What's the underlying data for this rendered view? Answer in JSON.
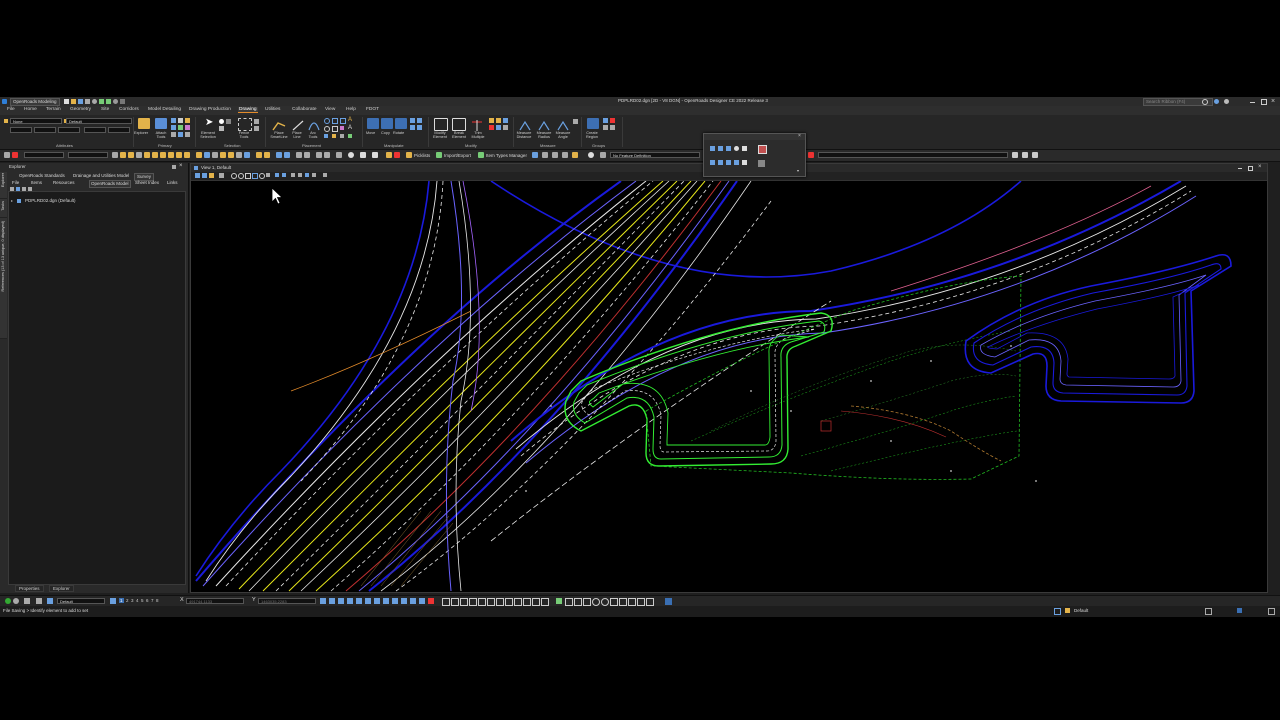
{
  "app": {
    "workflow": "OpenRoads Modeling",
    "title": "PDPLRD02.dgn [2D - V8 DGN] - OpenRoads Designer CE 2022 Release 3",
    "search_placeholder": "Search Ribbon (F4)"
  },
  "menu": {
    "items": [
      "File",
      "Home",
      "Terrain",
      "Geometry",
      "Site",
      "Corridors",
      "Model Detailing",
      "Drawing Production",
      "Drawing",
      "Utilities",
      "Collaborate",
      "View",
      "Help",
      "FDOT"
    ],
    "active": "Drawing"
  },
  "ribbon": {
    "level_value": "None",
    "style_value": "Default",
    "buttons": {
      "explorer": "Explorer",
      "attach_tools": "Attach Tools",
      "element_selection": "Element Selection",
      "fence_tools": "Fence Tools",
      "place_smartline": "Place SmartLine",
      "place_line": "Place Line",
      "arc_tools": "Arc Tools",
      "move": "Move",
      "copy": "Copy",
      "rotate": "Rotate",
      "modify_element": "Modify Element",
      "break_element": "Break Element",
      "trim_multiple": "Trim Multiple",
      "measure_distance": "Measure Distance",
      "measure_radius": "Measure Radius",
      "measure_angle": "Measure Angle",
      "create_region": "Create Region"
    },
    "groups": [
      "Attributes",
      "Primary",
      "Selection",
      "Placement",
      "Manipulate",
      "Modify",
      "Measure",
      "Groups"
    ]
  },
  "toolbar2": {
    "picklists": "Picklists",
    "import_export": "Import/Export",
    "item_types_manager": "Item Types Manager",
    "feature_definition": "No Feature Definition"
  },
  "explorer": {
    "title": "Explorer",
    "tabs_row1": [
      "OpenRoads Standards",
      "Drainage and Utilities Model",
      "Survey"
    ],
    "tabs_row2": [
      "File",
      "Items",
      "Resources",
      "OpenRoads Model",
      "Sheet Index",
      "Links"
    ],
    "side_tabs": [
      "Explorer",
      "Tasks",
      "References (13 of 13 unique, 0 displayed)"
    ],
    "tree_item": "PDPLRD02.dgn (Default)",
    "bottom_tabs": [
      "Properties",
      "Explorer"
    ]
  },
  "view": {
    "title": "View 1, Default"
  },
  "status": {
    "view_numbers": [
      "1",
      "2",
      "3",
      "4",
      "5",
      "6",
      "7",
      "8"
    ],
    "level_value": "Default",
    "x_label": "X",
    "x_value": "491744.1133",
    "y_label": "Y",
    "y_value": "1463035.2283",
    "message": "File Saving > Identify element to add to set",
    "model_label": "Default"
  },
  "colors": {
    "alignment_blue": "#1a1adc",
    "alignment_purple": "#6b63ff",
    "pond_green": "#33ee33",
    "contour_green": "#22bb22",
    "lane_yellow": "#e6e61a",
    "line_white": "#e8e8e8",
    "accent_orange": "#e38b2a"
  }
}
